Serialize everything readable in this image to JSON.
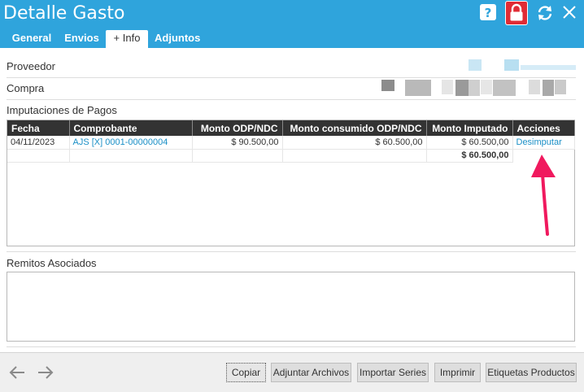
{
  "window": {
    "title": "Detalle Gasto"
  },
  "tabs": [
    {
      "label": "General"
    },
    {
      "label": "Envios"
    },
    {
      "label": "+ Info"
    },
    {
      "label": "Adjuntos"
    }
  ],
  "header_icons": [
    "help-icon",
    "lock-icon",
    "refresh-icon",
    "close-icon"
  ],
  "fields": {
    "proveedor_label": "Proveedor",
    "compra_label": "Compra"
  },
  "imputaciones": {
    "title": "Imputaciones de Pagos",
    "columns": [
      "Fecha",
      "Comprobante",
      "Monto ODP/NDC",
      "Monto consumido ODP/NDC",
      "Monto Imputado",
      "Acciones"
    ],
    "rows": [
      {
        "fecha": "04/11/2023",
        "comprobante": "AJS [X] 0001-00000004",
        "monto_odp": "$ 90.500,00",
        "monto_consumido": "$ 60.500,00",
        "monto_imputado": "$ 60.500,00",
        "accion": "Desimputar"
      }
    ],
    "total": "$ 60.500,00"
  },
  "remitos": {
    "title": "Remitos Asociados"
  },
  "nav_icons": [
    "arrow-left-icon",
    "arrow-right-icon"
  ],
  "buttons": {
    "copiar": "Copiar",
    "adjuntar": "Adjuntar Archivos",
    "importar": "Importar Series",
    "imprimir": "Imprimir",
    "etiquetas": "Etiquetas Productos"
  },
  "colors": {
    "header": "#2fa4dc",
    "lock_button": "#e02b35",
    "link": "#1a8fc6",
    "annotation_arrow": "#f0195e"
  }
}
